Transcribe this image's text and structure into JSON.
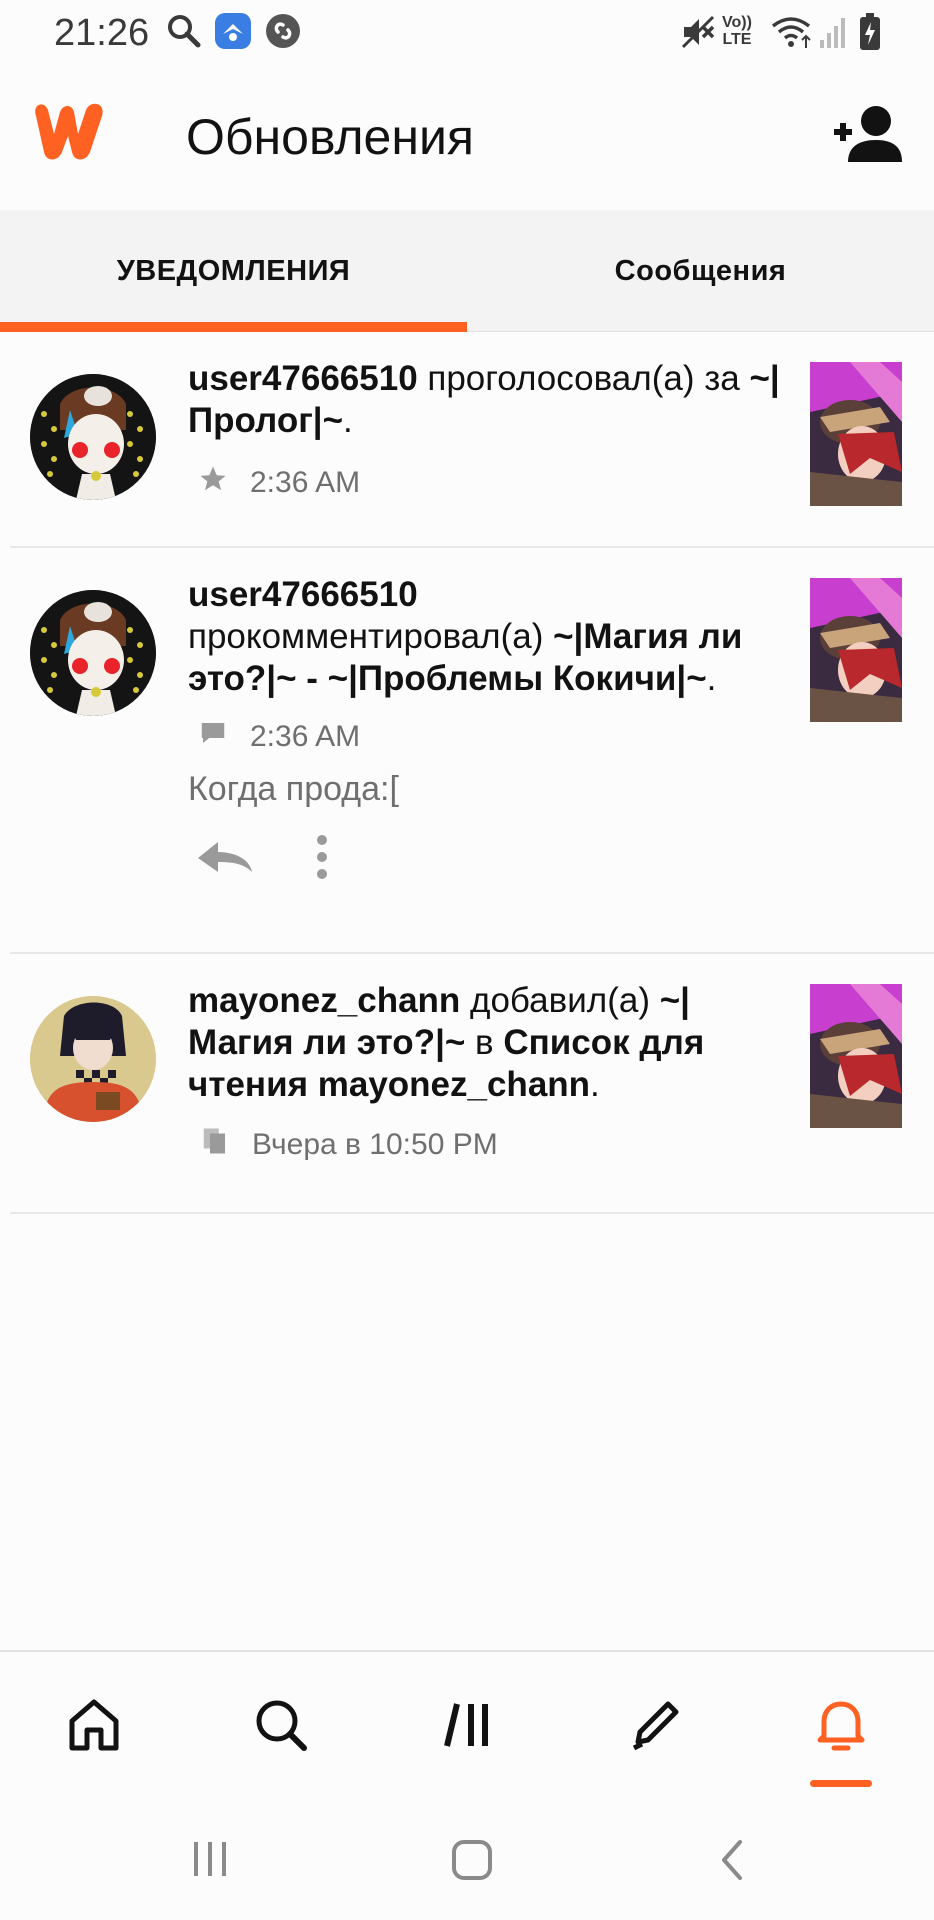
{
  "status_bar": {
    "time": "21:26",
    "icons": [
      "search-icon",
      "messenger-app-icon",
      "shazam-icon",
      "mute-icon",
      "volte-icon",
      "wifi-icon",
      "signal-icon",
      "battery-icon"
    ],
    "volte_label_top": "Vo))",
    "volte_label_bottom": "LTE"
  },
  "header": {
    "title": "Обновления",
    "logo": "wattpad-logo",
    "action_icon": "add-user-icon",
    "brand_color": "#ff6122"
  },
  "tabs": [
    {
      "label": "УВЕДОМЛЕНИЯ",
      "active": true
    },
    {
      "label": "Сообщения",
      "active": false
    }
  ],
  "feed": [
    {
      "user": "user47666510",
      "action": "проголосовал(а) за",
      "target": "~|Пролог|~",
      "suffix": ".",
      "meta_icon": "star-icon",
      "time": "2:36 AM"
    },
    {
      "user": "user47666510",
      "action": "прокомментировал(а)",
      "target": "~|Магия ли это?|~ - ~|Проблемы Кокичи|~",
      "suffix": ".",
      "meta_icon": "comment-icon",
      "time": "2:36 AM",
      "comment": "Когда прода:[",
      "actions": [
        "reply-icon",
        "more-options-icon"
      ]
    },
    {
      "user": "mayonez_chann",
      "action": "добавил(а)",
      "target": "~|Магия ли это?|~",
      "connector": "в",
      "list": "Список для чтения mayonez_chann",
      "suffix": ".",
      "meta_icon": "reading-list-icon",
      "time": "Вчера в 10:50 PM"
    }
  ],
  "bottom_nav": {
    "items": [
      "home-icon",
      "search-icon",
      "library-icon",
      "write-icon",
      "notifications-icon"
    ],
    "active": "notifications-icon"
  },
  "system_nav": [
    "recents-button",
    "home-button",
    "back-button"
  ]
}
